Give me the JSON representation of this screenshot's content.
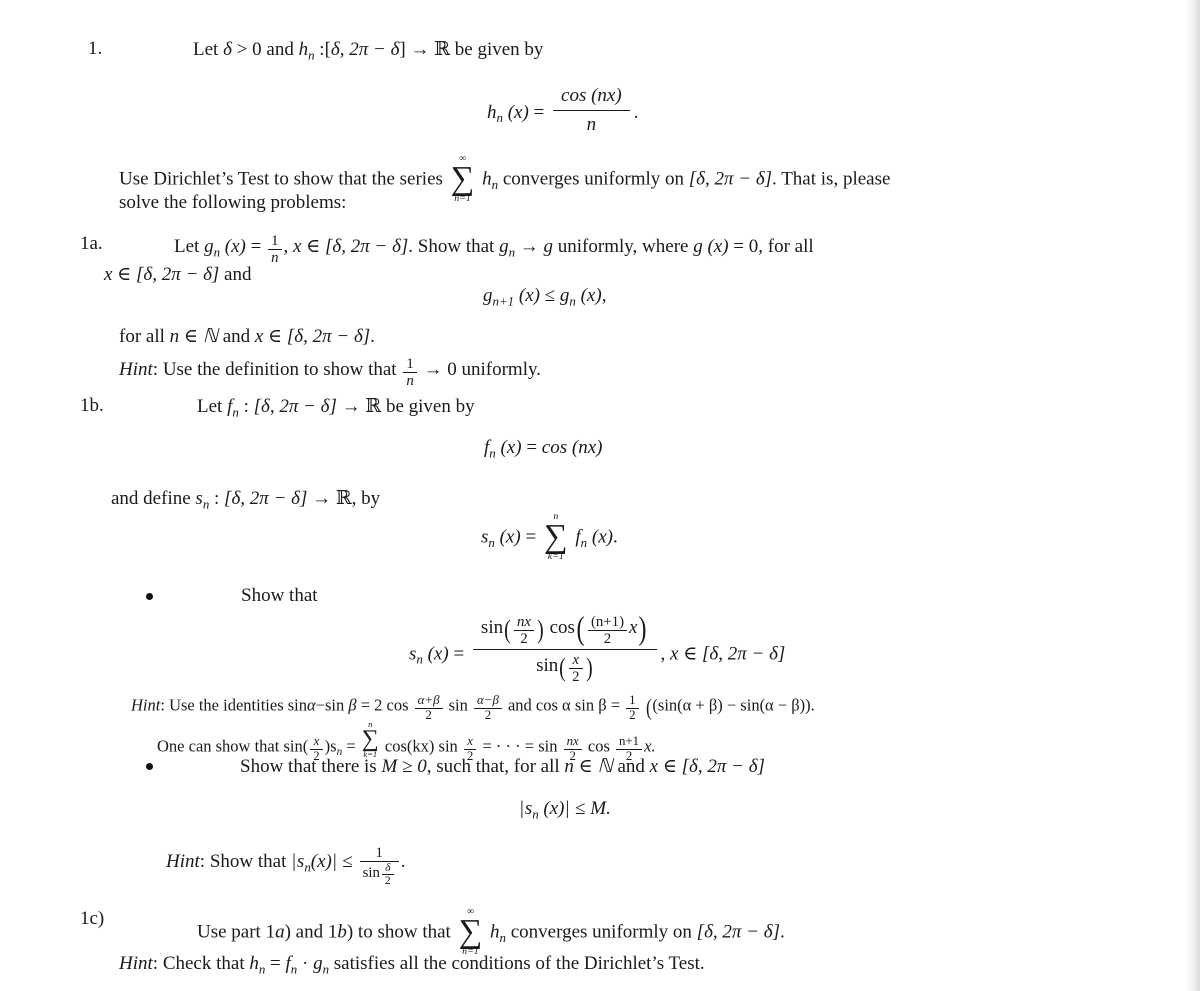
{
  "document": {
    "type": "math-problem-set",
    "topic": "Dirichlet's Test for uniform convergence of series of functions"
  },
  "problem1": {
    "label": "1.",
    "intro": "Let δ > 0 and hₙ : [δ, 2π − δ] → ℝ be given by",
    "intro_parts": {
      "let": "Let",
      "delta": "δ",
      "gt_zero": "> 0 and",
      "h": "h",
      "n": "n",
      "colon": ":",
      "interval_open": "[",
      "interval_text": "δ, 2π − δ",
      "interval_close": "]",
      "arrow": "→",
      "reals": "ℝ",
      "given_by": "be given by"
    },
    "display_formula": {
      "lhs": "h",
      "lhs_sub": "n",
      "lhs_arg": "(x)",
      "equals": "=",
      "numerator": "cos (nx)",
      "denominator": "n",
      "period": "."
    },
    "body_line1": {
      "pre": "Use Dirichlet’s Test to show that the series",
      "sum_top": "∞",
      "sum_sigma": "∑",
      "sum_bot": "n=1",
      "term_h": "h",
      "term_sub": "n",
      "mid": "converges uniformly on",
      "interval": "[δ, 2π − δ]",
      "post": ". That is, please"
    },
    "body_line2": "solve the following problems:"
  },
  "problem1a": {
    "label": "1a.",
    "line1": {
      "let": "Let",
      "g": "g",
      "g_sub": "n",
      "arg": "(x)",
      "equals": "=",
      "frac_num": "1",
      "frac_den": "n",
      "comma": ",",
      "x_in": "x ∈",
      "interval": "[δ, 2π − δ]",
      "period": ".",
      "show_that": "Show that",
      "gn": "g",
      "gn_sub": "n",
      "arrow": "→",
      "g_lim": "g",
      "uniformly": "uniformly, where",
      "gx": "g (x)",
      "eq_zero": "= 0, for all"
    },
    "line2": {
      "x_in": "x ∈",
      "interval": "[δ, 2π − δ]",
      "and": "and"
    },
    "display_formula": {
      "lhs": "g",
      "lhs_sub": "n+1",
      "lhs_arg": "(x)",
      "rel": "≤",
      "rhs": "g",
      "rhs_sub": "n",
      "rhs_arg": "(x)",
      "comma": ","
    },
    "line3": {
      "pre": "for all",
      "n_in_N": "n ∈ ℕ",
      "and": "and",
      "x_in": "x ∈",
      "interval": "[δ, 2π − δ]",
      "period": "."
    },
    "hint": {
      "word": "Hint",
      "colon": ":",
      "text_pre": "Use the definition to show that",
      "frac_num": "1",
      "frac_den": "n",
      "arrow": "→",
      "text_post": "0 uniformly."
    }
  },
  "problem1b": {
    "label": "1b.",
    "line1": {
      "let": "Let",
      "f": "f",
      "f_sub": "n",
      "colon": ":",
      "interval": "[δ, 2π − δ]",
      "arrow": "→",
      "reals": "ℝ",
      "given_by": "be given by"
    },
    "display_formula": {
      "lhs": "f",
      "lhs_sub": "n",
      "lhs_arg": "(x)",
      "equals": "=",
      "rhs": "cos (nx)"
    },
    "line2": {
      "pre": "and define",
      "s": "s",
      "s_sub": "n",
      "colon": ":",
      "interval": "[δ, 2π − δ]",
      "arrow": "→",
      "reals": "ℝ",
      "post": ", by"
    },
    "display_sum": {
      "lhs": "s",
      "lhs_sub": "n",
      "lhs_arg": "(x)",
      "equals": "=",
      "sum_top": "n",
      "sum_sigma": "∑",
      "sum_bot": "k=1",
      "term": "f",
      "term_sub": "n",
      "term_arg": "(x)",
      "period": "."
    },
    "bullet1": {
      "text": "Show that",
      "formula": {
        "lhs": "s",
        "lhs_sub": "n",
        "lhs_arg": "(x)",
        "equals": "=",
        "num_sin": "sin",
        "num_sin_arg_num": "nx",
        "num_sin_arg_den": "2",
        "num_cos": "cos",
        "num_cos_arg_num": "(n+1)",
        "num_cos_arg_den": "2",
        "num_cos_x": "x",
        "den_sin": "sin",
        "den_arg_num": "x",
        "den_arg_den": "2",
        "comma": ",",
        "x_in": "x ∈",
        "interval": "[δ, 2π − δ]"
      },
      "hint_line1": {
        "word": "Hint",
        "colon": ":",
        "pre": "Use the identities sin",
        "alpha": "α",
        "minus_sin": "−sin",
        "beta": "β",
        "eq": "= 2 cos",
        "f1_num": "α+β",
        "f1_den": "2",
        "sin2": "sin",
        "f2_num": "α−β",
        "f2_den": "2",
        "and_cos": "and cos α sin β =",
        "half_num": "1",
        "half_den": "2",
        "tail": "(sin(α + β) − sin(α − β))."
      },
      "hint_line2": {
        "pre": "One can show that sin(",
        "xhalf_num": "x",
        "xhalf_den": "2",
        "mid1": ")s",
        "s_sub": "n",
        "eq1": "=",
        "sum_top": "n",
        "sum_sigma": "∑",
        "sum_bot": "k=1",
        "cos_kx": "cos(kx) sin",
        "sin_arg_num": "x",
        "sin_arg_den": "2",
        "eq2": "= · · · =",
        "sin2": "sin",
        "nx_num": "nx",
        "nx_den": "2",
        "cos2": "cos",
        "np1_num": "n+1",
        "np1_den": "2",
        "x_end": "x."
      }
    },
    "bullet2": {
      "text_pre": "Show that there is",
      "M": "M ≥ 0",
      "text_mid": ", such that, for all",
      "n_in_N": "n ∈ ℕ",
      "and": "and",
      "x_in": "x ∈",
      "interval": "[δ, 2π − δ]",
      "formula": {
        "bar_l": "|",
        "s": "s",
        "s_sub": "n",
        "arg": "(x)",
        "bar_r": "|",
        "rel": "≤",
        "M": "M."
      },
      "hint": {
        "word": "Hint",
        "colon": ":",
        "pre": "Show that",
        "bar_l": "|",
        "s": "s",
        "s_sub": "n",
        "arg": "(x)",
        "bar_r": "|",
        "rel": "≤",
        "frac_num": "1",
        "frac_den_sin": "sin",
        "frac_den_num": "δ",
        "frac_den_den": "2",
        "period": "."
      }
    }
  },
  "problem1c": {
    "label": "1c)",
    "line1": {
      "pre": "Use part 1",
      "a_it": "a",
      "mid1": ") and 1",
      "b_it": "b",
      "mid2": ") to show that",
      "sum_top": "∞",
      "sum_sigma": "∑",
      "sum_bot": "n=1",
      "term": "h",
      "term_sub": "n",
      "post": "converges uniformly on",
      "interval": "[δ, 2π − δ]",
      "period": "."
    },
    "hint": {
      "word": "Hint",
      "colon": ":",
      "pre": "Check that",
      "h": "h",
      "h_sub": "n",
      "eq": "=",
      "f": "f",
      "f_sub": "n",
      "dot": "·",
      "g": "g",
      "g_sub": "n",
      "post": "satisfies all the conditions of the Dirichlet’s Test."
    }
  },
  "colors": {
    "page_background": "#ffffff",
    "text": "#1a1a1a",
    "edge_shade": "#dcdcdc"
  }
}
